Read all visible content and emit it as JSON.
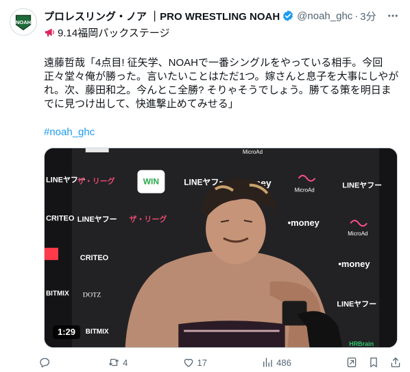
{
  "account": {
    "display_name": "プロレスリング・ノア ｜PRO WRESTLING NOAH",
    "handle": "@noah_ghc",
    "separator": "·",
    "time": "3分",
    "avatar_text": "NOAH",
    "verified_color": "#1d9bf0"
  },
  "tweet": {
    "event_line": "9.14福岡パックステージ",
    "text": "遠藤哲哉「4点目! 征矢学、NOAHで一番シングルをやっている相手。今回正々堂々俺が勝った。言いたいことはただ1つ。嫁さんと息子を大事にしやがれ。次、藤田和之。今んとこ全勝? そりゃそうでしょう。勝てる策を明日までに見つけ出して、快進撃止めてみせる」",
    "hashtag": "#noah_ghc"
  },
  "media": {
    "duration": "1:29",
    "backdrop_logos": [
      "LINEヤフー",
      "•money",
      "MicroAd",
      "ザ・リーグ",
      "WIN",
      "CRITEO",
      "DOTZ",
      "BITMIX",
      "HRBrain"
    ]
  },
  "actions": {
    "replies": "",
    "reposts": "4",
    "likes": "17",
    "views": "486"
  },
  "colors": {
    "text": "#0f1419",
    "secondary": "#536471",
    "accent": "#1d9bf0",
    "megaphone": "#e0245e"
  }
}
